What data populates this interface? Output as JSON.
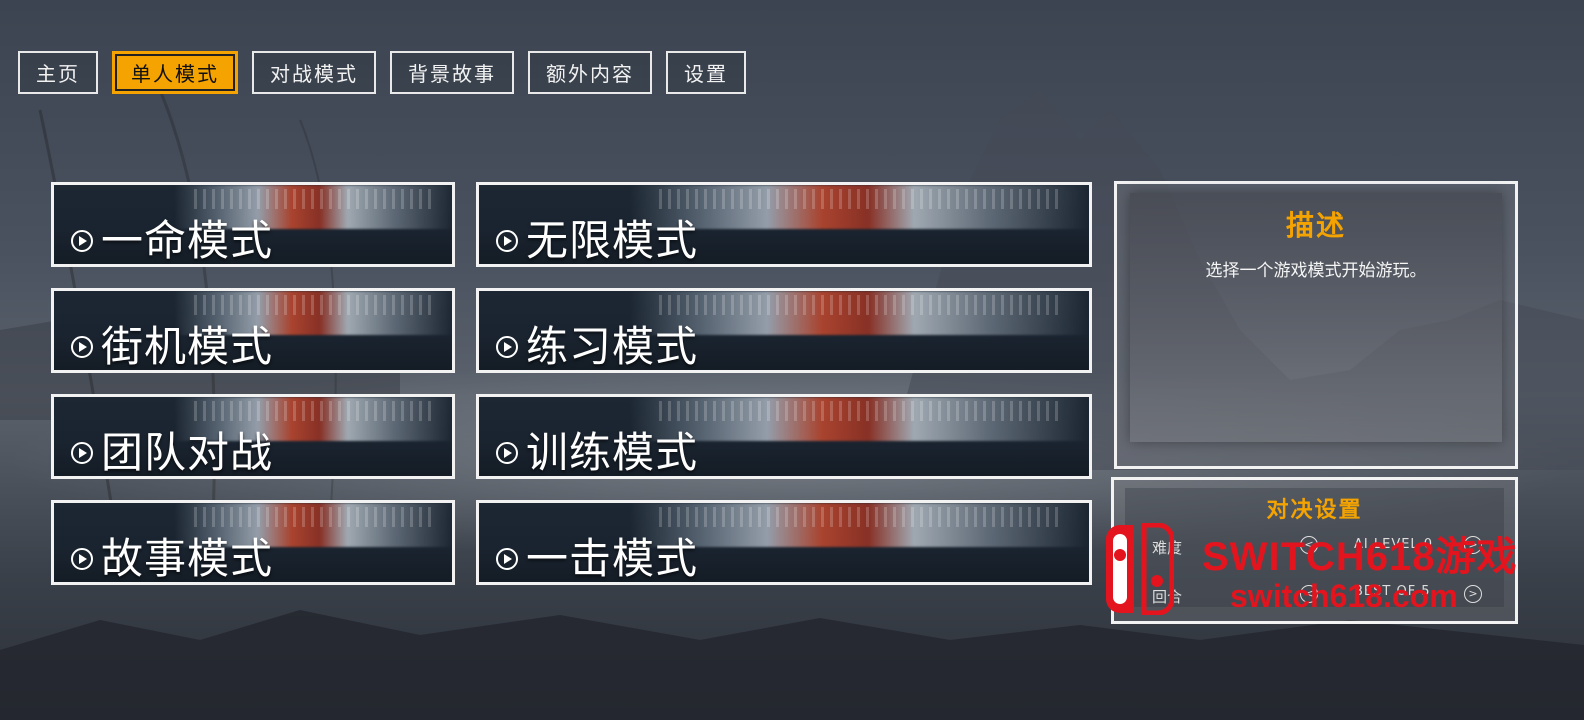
{
  "nav": {
    "tabs": [
      {
        "label": "主页"
      },
      {
        "label": "单人模式"
      },
      {
        "label": "对战模式"
      },
      {
        "label": "背景故事"
      },
      {
        "label": "额外内容"
      },
      {
        "label": "设置"
      }
    ],
    "active_index": 1
  },
  "modes": [
    {
      "label": "一命模式"
    },
    {
      "label": "无限模式"
    },
    {
      "label": "街机模式"
    },
    {
      "label": "练习模式"
    },
    {
      "label": "团队对战"
    },
    {
      "label": "训练模式"
    },
    {
      "label": "故事模式"
    },
    {
      "label": "一击模式"
    }
  ],
  "description": {
    "title": "描述",
    "text": "选择一个游戏模式开始游玩。"
  },
  "match_settings": {
    "title": "对决设置",
    "rows": [
      {
        "label": "难度",
        "value": "AI LEVEL 0"
      },
      {
        "label": "回合",
        "value": "BEST OF 5"
      }
    ]
  },
  "watermark": {
    "line1": "SWITCH618游戏",
    "line2": "switch618.com"
  },
  "colors": {
    "accent": "#f4a300",
    "watermark": "#e4141e",
    "border": "#f2f2f2"
  }
}
